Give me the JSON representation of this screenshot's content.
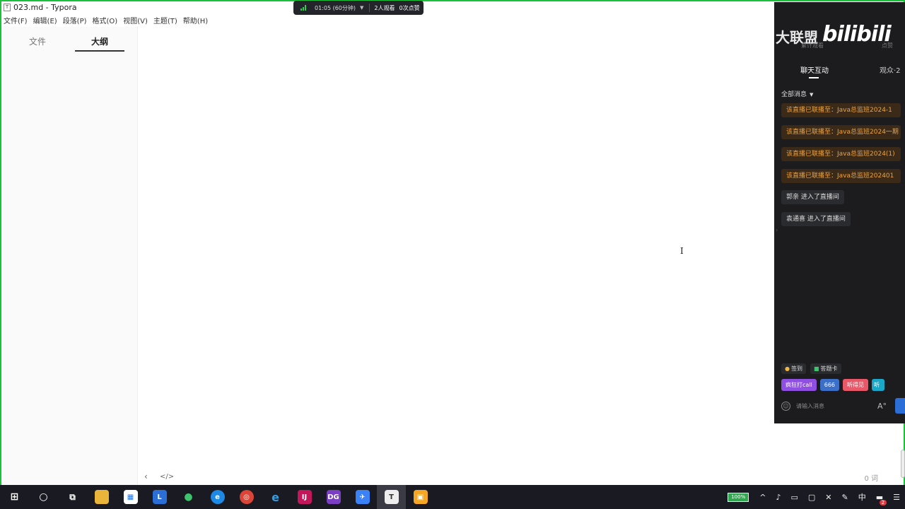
{
  "window": {
    "title": "023.md - Typora",
    "app_icon_letter": "T"
  },
  "menu": [
    "文件(F)",
    "编辑(E)",
    "段落(P)",
    "格式(O)",
    "视图(V)",
    "主题(T)",
    "帮助(H)"
  ],
  "sidebar": {
    "tabs": [
      "文件",
      "大纲"
    ],
    "active_tab": "大纲"
  },
  "editor": {
    "word_count": "0 词",
    "nav_back": "‹",
    "source_toggle": "</>"
  },
  "live_bar": {
    "time": "01:05 (60分钟)",
    "viewers": "2人观看",
    "likes": "0次点赞"
  },
  "panel": {
    "union_text": "大联盟",
    "logo": "bilibili",
    "sub_left": "累计观看",
    "sub_right": "点赞",
    "tabs": {
      "chat": "聊天互动",
      "audience": "观众·2"
    },
    "filter": "全部消息",
    "messages": [
      {
        "type": "system",
        "text": "该直播已联播至：Java总监班2024-1"
      },
      {
        "type": "system",
        "text": "该直播已联播至：Java总监班2024一期"
      },
      {
        "type": "system",
        "text": "该直播已联播至：Java总监班2024(1)"
      },
      {
        "type": "system",
        "text": "该直播已联播至：Java总监班202401"
      },
      {
        "type": "user",
        "text": "郭亲 进入了直播间"
      },
      {
        "type": "user",
        "text": "袁通喜 进入了直播间"
      }
    ],
    "tools": {
      "checkin": "签到",
      "answer_card": "答题卡"
    },
    "quick_replies": [
      "疯狂打call",
      "666",
      "听得见",
      "听"
    ],
    "input_placeholder": "请输入消息",
    "font_toggle": "A°"
  },
  "taskbar": {
    "icons": [
      "windows-start",
      "search",
      "task-view",
      "file-explorer",
      "store",
      "lark",
      "wechat",
      "edge",
      "chrome",
      "ie",
      "intellij",
      "datagrip",
      "feishu",
      "typora",
      "app-orange"
    ],
    "battery": "100%",
    "ime": "中",
    "notification_count": "2"
  },
  "colors": {
    "accent_green": "#19c23a",
    "system_msg": "#f0a23c",
    "panel_bg": "#1c1c1f"
  }
}
